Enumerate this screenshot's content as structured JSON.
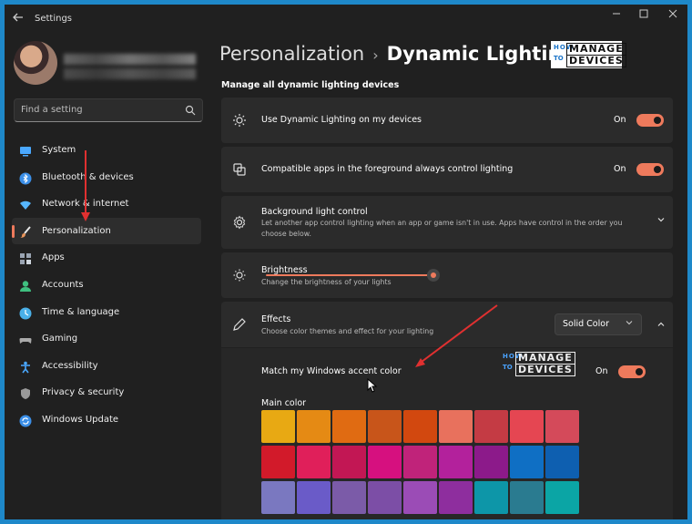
{
  "window": {
    "title": "Settings",
    "back_icon": "back-arrow-icon"
  },
  "sidebar": {
    "search_placeholder": "Find a setting",
    "items": [
      {
        "label": "System",
        "icon": "display-icon",
        "color": "#4aa8ff"
      },
      {
        "label": "Bluetooth & devices",
        "icon": "bluetooth-icon",
        "color": "#3b8fe8"
      },
      {
        "label": "Network & internet",
        "icon": "wifi-icon",
        "color": "#56b6ff"
      },
      {
        "label": "Personalization",
        "icon": "brush-icon",
        "color": "#e8945a",
        "active": true
      },
      {
        "label": "Apps",
        "icon": "apps-icon",
        "color": "#9aa4b2"
      },
      {
        "label": "Accounts",
        "icon": "person-icon",
        "color": "#3fbf7f"
      },
      {
        "label": "Time & language",
        "icon": "globe-clock-icon",
        "color": "#4ab0e8"
      },
      {
        "label": "Gaming",
        "icon": "gamepad-icon",
        "color": "#aaaaaa"
      },
      {
        "label": "Accessibility",
        "icon": "accessibility-icon",
        "color": "#4aa8ff"
      },
      {
        "label": "Privacy & security",
        "icon": "shield-icon",
        "color": "#9a9a9a"
      },
      {
        "label": "Windows Update",
        "icon": "update-icon",
        "color": "#3b8fe8"
      }
    ]
  },
  "breadcrumb": {
    "parent": "Personalization",
    "separator": "›",
    "current": "Dynamic Lighting"
  },
  "watermark": {
    "how": "HOW",
    "to": "TO",
    "line1": "MANAGE",
    "line2": "DEVICES"
  },
  "main": {
    "section_heading": "Manage all dynamic lighting devices",
    "use_dynamic": {
      "title": "Use Dynamic Lighting on my devices",
      "state": "On"
    },
    "compatible_apps": {
      "title": "Compatible apps in the foreground always control lighting",
      "state": "On"
    },
    "background": {
      "title": "Background light control",
      "subtitle": "Let another app control lighting when an app or game isn't in use. Apps have control in the order you choose below."
    },
    "brightness": {
      "title": "Brightness",
      "subtitle": "Change the brightness of your lights",
      "value": 0.97
    },
    "effects": {
      "title": "Effects",
      "subtitle": "Choose color themes and effect for your lighting",
      "dropdown_value": "Solid Color"
    },
    "match_accent": {
      "title": "Match my Windows accent color",
      "state": "On"
    },
    "main_color_label": "Main color",
    "swatch_rows": [
      [
        "#e8a913",
        "#e58a14",
        "#e06b12",
        "#c8551a",
        "#d2480f",
        "#e8715d",
        "#c43b44",
        "#e54652",
        "#d44a5a"
      ],
      [
        "#d21a2a",
        "#e01f5a",
        "#c21754",
        "#d6107f",
        "#c0237a",
        "#b3219c",
        "#8c1a8a",
        "#0f6fc4",
        "#0e5fb0"
      ],
      [
        "#7a78c0",
        "#6a5bc8",
        "#7b5ba8",
        "#7c4ea6",
        "#9b4cb6",
        "#8e2e9e",
        "#0d96a8",
        "#2a7b90",
        "#0ba5a5"
      ]
    ]
  }
}
